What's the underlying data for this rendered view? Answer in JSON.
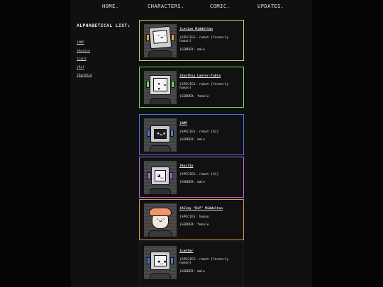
{
  "nav": [
    "HOME.",
    "CHARACTERS.",
    "COMIC.",
    "UPDATES."
  ],
  "sidebar": {
    "title": "ALPHABETICAL LIST:",
    "items": [
      "}AMP",
      "}Austin",
      "}Lanz",
      "}Rif",
      "}Synthia"
    ]
  },
  "cards": [
    {
      "name": "}Levian Middelton",
      "species": "}SPECIES: robot [formerly human]",
      "gender": "}GENDER: male",
      "border": "#d8c07a",
      "accent": "#f2a13a"
    },
    {
      "name": "}Synthia Lanter-Table",
      "species": "}SPECIES: robot [formerly human]",
      "gender": "}GENDER: female",
      "border": "#7cd06a",
      "accent": "#54e06a"
    },
    {
      "name": "}AMP",
      "species": "}SPECIES: robot [AI]",
      "gender": "}GENDER: male",
      "border": "#4d6ee0",
      "accent": "#4a72ee"
    },
    {
      "name": "}Austin",
      "species": "}SPECIES: robot [AI]",
      "gender": "}GENDER: male",
      "border": "#b86ed0",
      "accent": "#c058e8"
    },
    {
      "name": "}Riley \"Rif\" Middelton",
      "species": "}SPECIES: human",
      "gender": "}GENDER: female",
      "border": "#d89a52",
      "accent": "#f0966e"
    },
    {
      "name": "}Lanter",
      "species": "}SPECIES: robot [formerly human]",
      "gender": "}GENDER: male",
      "border": "#222222",
      "accent": "#4a72ee"
    }
  ]
}
